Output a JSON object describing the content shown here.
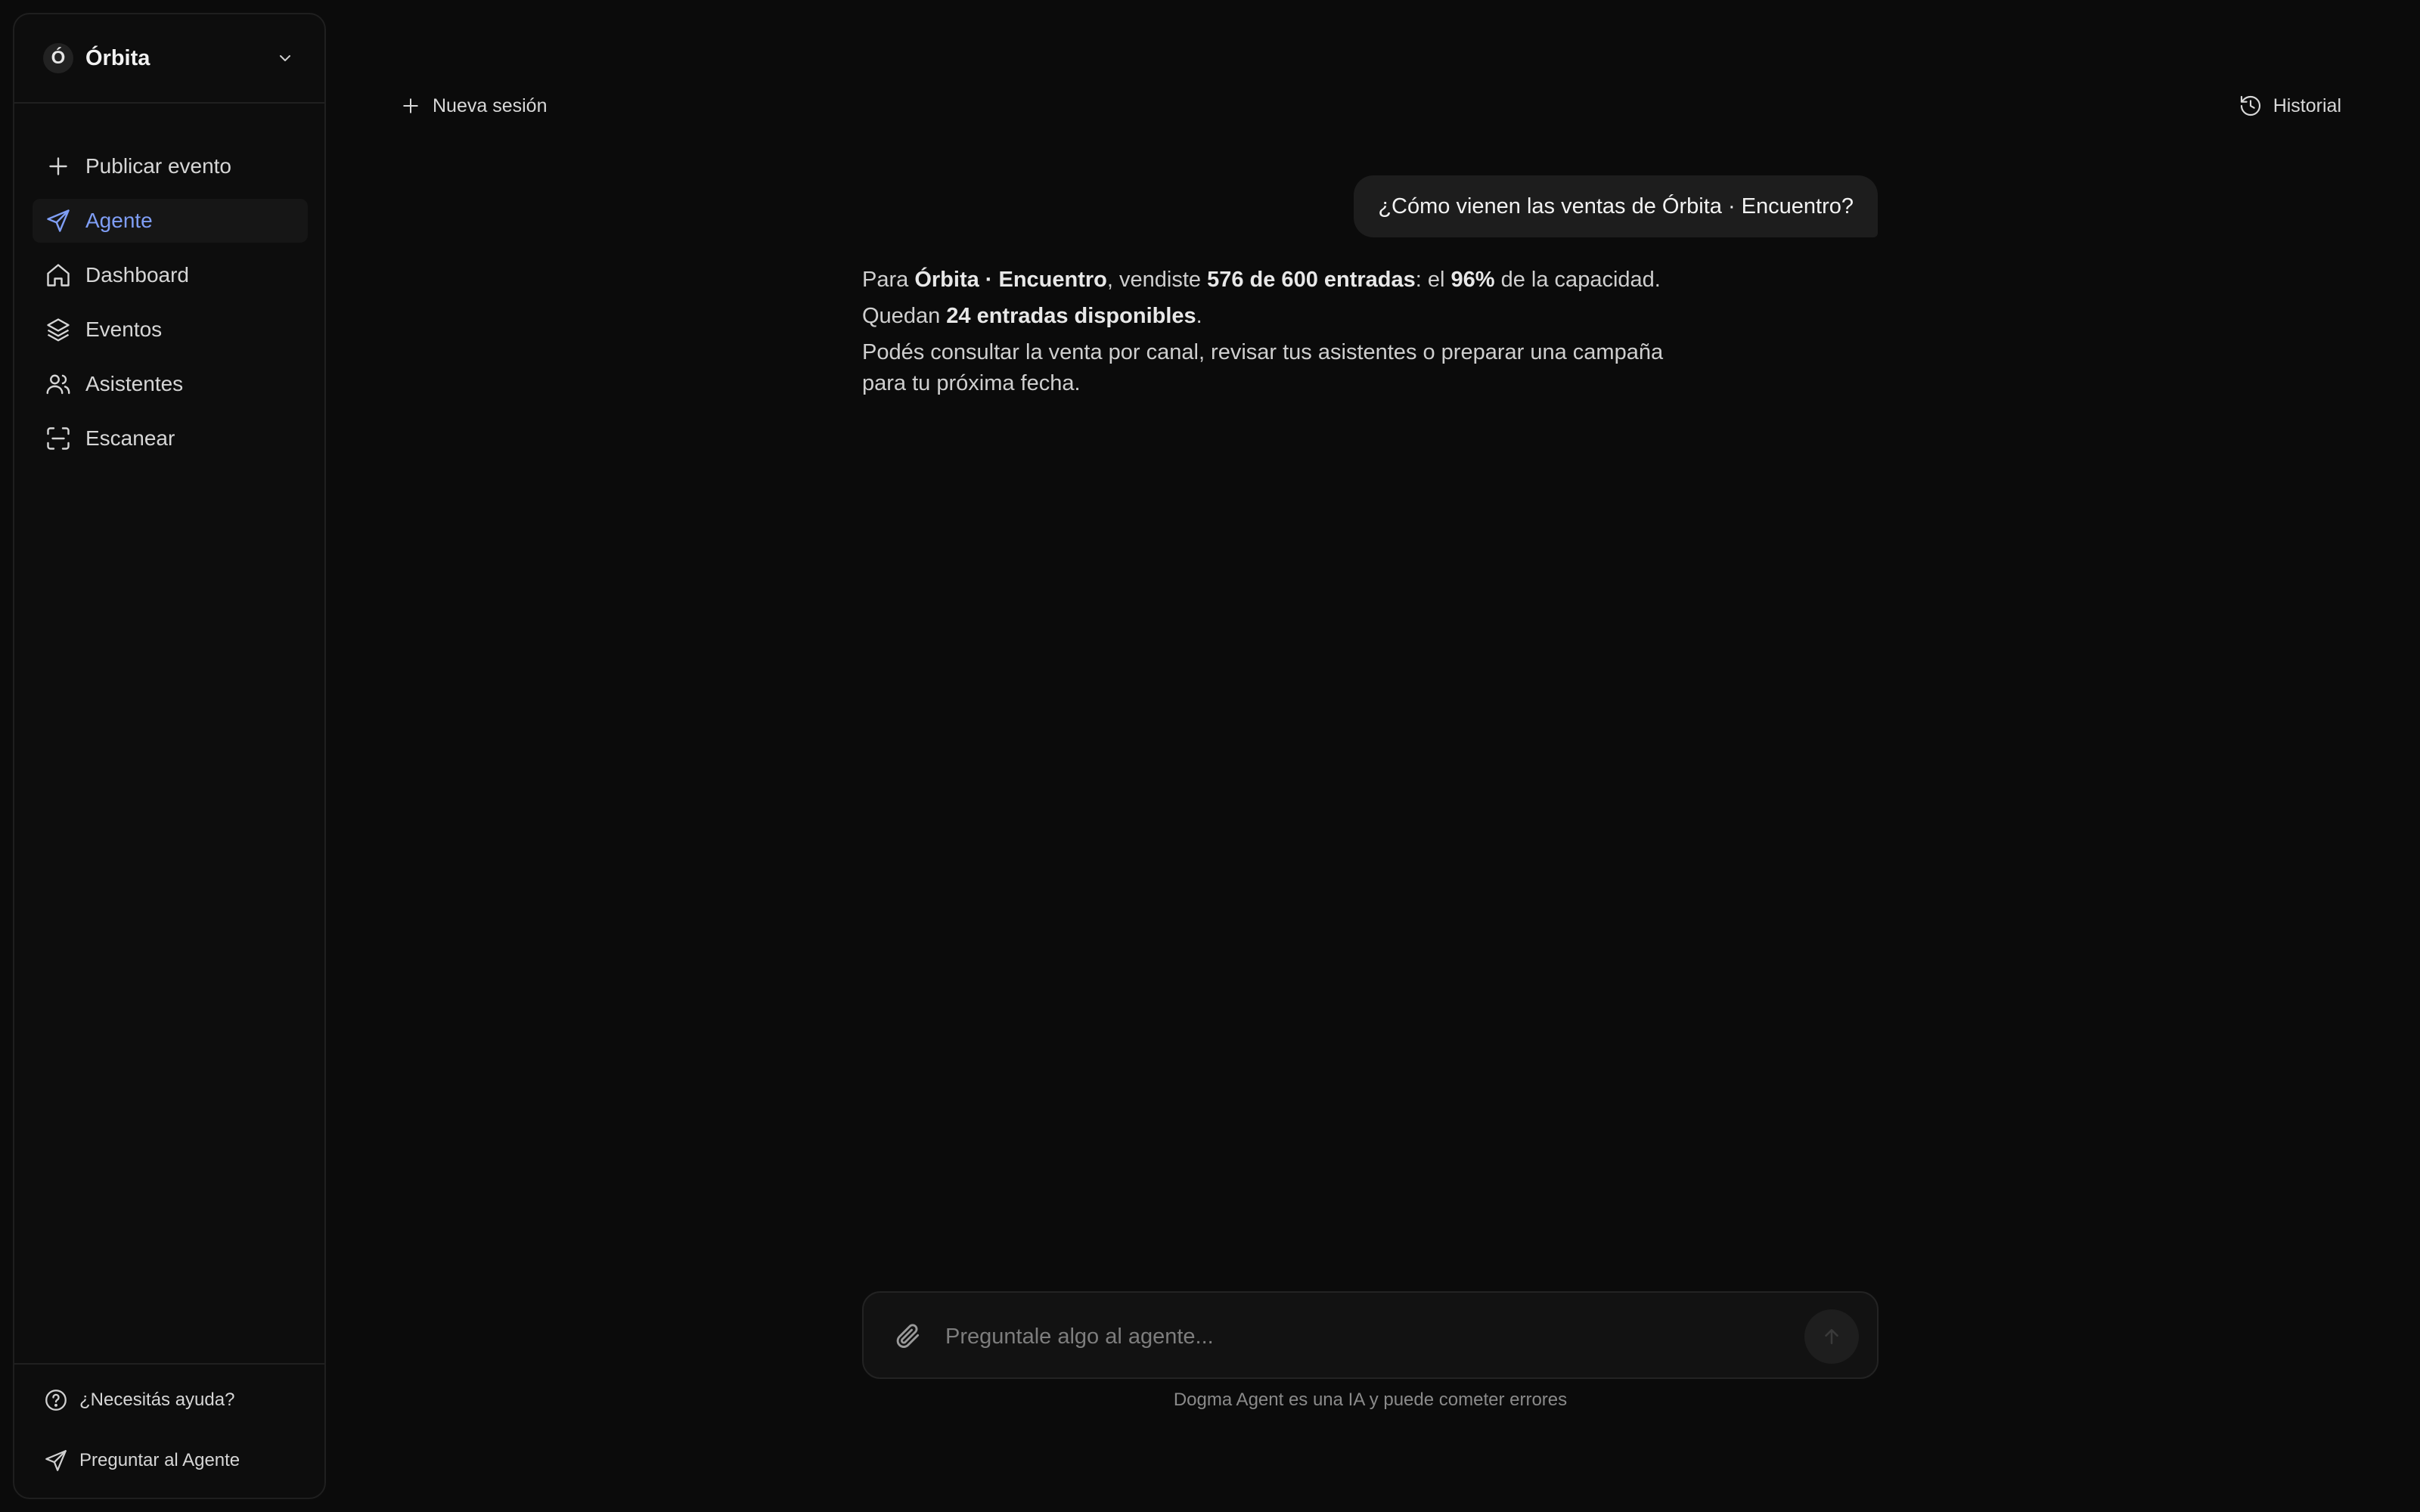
{
  "sidebar": {
    "workspace": {
      "initial": "Ó",
      "name": "Órbita"
    },
    "items": [
      {
        "label": "Publicar evento",
        "icon": "plus-icon"
      },
      {
        "label": "Agente",
        "icon": "send-icon",
        "active": true
      },
      {
        "label": "Dashboard",
        "icon": "home-icon"
      },
      {
        "label": "Eventos",
        "icon": "layers-icon"
      },
      {
        "label": "Asistentes",
        "icon": "users-icon"
      },
      {
        "label": "Escanear",
        "icon": "scan-icon"
      }
    ],
    "footer": {
      "help_label": "¿Necesitás ayuda?",
      "ask_agent_label": "Preguntar al Agente"
    }
  },
  "topbar": {
    "new_session_label": "Nueva sesión",
    "history_label": "Historial"
  },
  "chat": {
    "user_message": "¿Cómo vienen las ventas de Órbita · Encuentro?",
    "assistant": {
      "line1": {
        "t1": "Para ",
        "event": "Órbita · Encuentro",
        "t2": ", vendiste ",
        "sold": "576 de 600 entradas",
        "t3": ": el ",
        "pct": "96%",
        "t4": " de la capacidad."
      },
      "line2": {
        "t1": "Quedan ",
        "remaining": "24 entradas disponibles",
        "t2": "."
      },
      "line3": "Podés consultar la venta por canal, revisar tus asistentes o preparar una campaña para tu próxima fecha."
    }
  },
  "composer": {
    "placeholder": "Preguntale algo al agente...",
    "value": "",
    "disclaimer": "Dogma Agent es una IA y puede cometer errores"
  },
  "colors": {
    "background": "#0b0b0b",
    "accent": "#7f9ef5",
    "bubble": "#1d1d1d"
  }
}
